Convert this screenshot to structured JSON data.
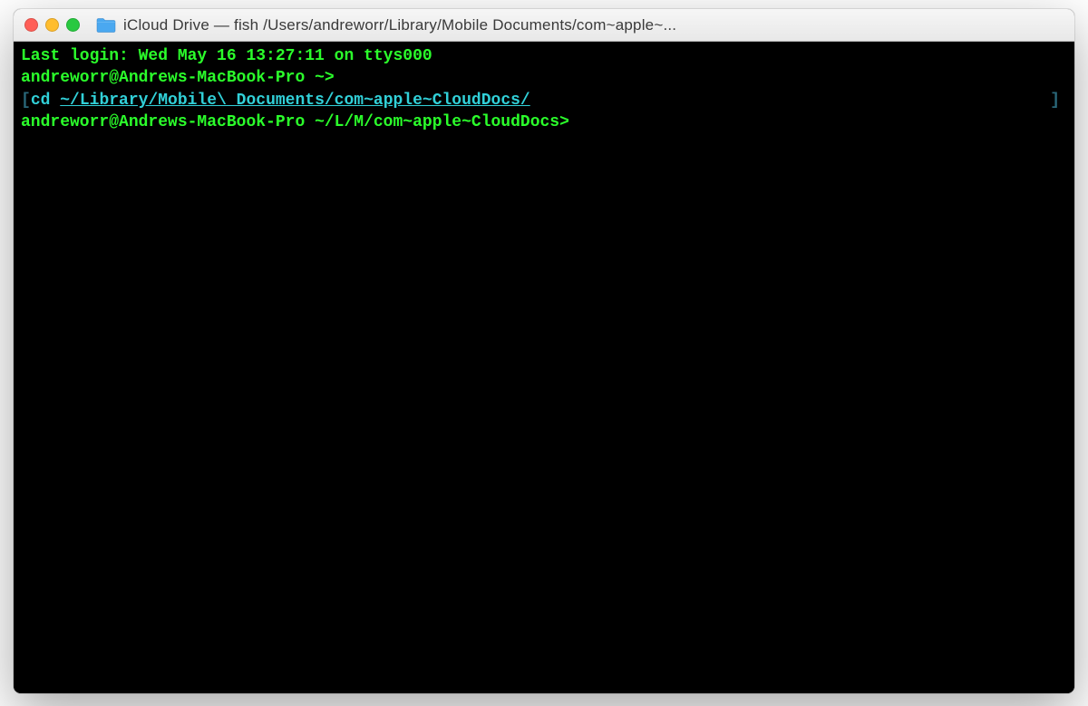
{
  "window": {
    "title": "iCloud Drive — fish  /Users/andreworr/Library/Mobile Documents/com~apple~..."
  },
  "terminal": {
    "last_login": "Last login: Wed May 16 13:27:11 on ttys000",
    "prompt1_user": "andreworr@Andrews-MacBook-Pro",
    "prompt1_path": " ~> ",
    "cmd_left_bracket": "[",
    "cmd_name": "cd",
    "cmd_space": " ",
    "cmd_path": "~/Library/Mobile\\ Documents/com~apple~CloudDocs/",
    "cmd_right_bracket": "]",
    "prompt2_user": "andreworr@Andrews-MacBook-Pro",
    "prompt2_path": " ~/L/M/com~apple~CloudDocs> "
  },
  "colors": {
    "terminal_bg": "#000000",
    "terminal_green": "#2bff2b",
    "terminal_cyan": "#31d0d8",
    "terminal_darkcyan": "#2a687a"
  }
}
